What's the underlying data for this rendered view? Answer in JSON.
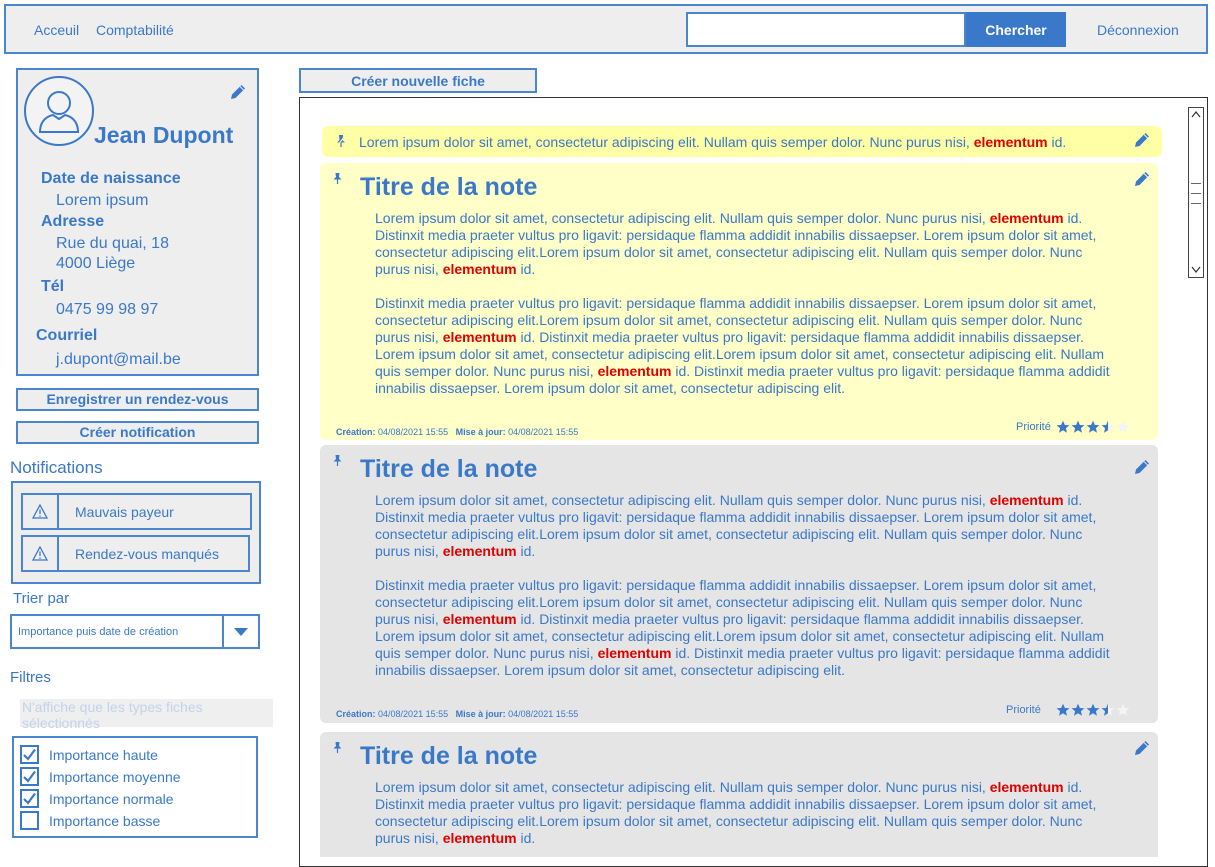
{
  "header": {
    "nav_home": "Acceuil",
    "nav_accounting": "Comptabilité",
    "search_value": "",
    "search_button": "Chercher",
    "logout": "Déconnexion"
  },
  "profile": {
    "name": "Jean Dupont",
    "birth_label": "Date de naissance",
    "birth_value": "Lorem ipsum",
    "address_label": "Adresse",
    "address_line1": "Rue du quai, 18",
    "address_line2": "4000 Liège",
    "phone_label": "Tél",
    "phone_value": "0475 99 98 97",
    "email_label": "Courriel",
    "email_value": "j.dupont@mail.be"
  },
  "actions": {
    "appointment": "Enregistrer un rendez-vous",
    "notification": "Créer notification",
    "create_sheet": "Créer nouvelle fiche"
  },
  "notifications": {
    "title": "Notifications",
    "items": [
      {
        "label": "Mauvais payeur"
      },
      {
        "label": "Rendez-vous manqués"
      }
    ]
  },
  "sort": {
    "title": "Trier par",
    "value": "Importance puis date de création"
  },
  "filters": {
    "title": "Filtres",
    "hint": "N'affiche que les types fiches sélectionnés",
    "items": [
      {
        "label": "Importance haute",
        "checked": true
      },
      {
        "label": "Importance moyenne",
        "checked": true
      },
      {
        "label": "Importance normale",
        "checked": true
      },
      {
        "label": "Importance basse",
        "checked": false
      }
    ]
  },
  "banner": {
    "text_before": "Lorem ipsum dolor sit amet, consectetur adipiscing elit. Nullam quis semper dolor. Nunc purus nisi, ",
    "highlight": "elementum",
    "text_after": " id."
  },
  "text": {
    "p1a": "Lorem ipsum dolor sit amet, consectetur adipiscing elit. Nullam quis semper dolor. Nunc purus nisi, ",
    "hl": "elementum",
    "p1b": " id. Distinxit  media praeter vultus pro ligavit: persidaque flamma addidit innabilis dissaepser. Lorem ipsum dolor sit amet, consectetur adipiscing elit.Lorem ipsum dolor sit amet, consectetur adipiscing elit. Nullam quis semper dolor. Nunc purus nisi, ",
    "p1c": " id.",
    "p2a": "Distinxit  media praeter vultus pro ligavit: persidaque flamma addidit innabilis dissaepser. Lorem ipsum dolor sit amet, consectetur adipiscing elit.Lorem ipsum dolor sit amet, consectetur adipiscing elit. Nullam quis semper dolor. Nunc purus nisi, ",
    "p2b": " id. Distinxit  media praeter vultus pro ligavit: persidaque flamma addidit innabilis dissaepser. Lorem ipsum dolor sit amet, consectetur adipiscing elit.Lorem ipsum dolor sit amet, consectetur adipiscing elit. Nullam quis semper dolor. Nunc purus nisi, ",
    "p2c": " id. Distinxit  media praeter vultus pro ligavit: persidaque flamma addidit innabilis dissaepser. Lorem ipsum dolor sit amet, consectetur adipiscing elit."
  },
  "notes": [
    {
      "title": "Titre de la note",
      "created_label": "Création:",
      "created": "04/08/2021 15:55",
      "updated_label": "Mise à jour:",
      "updated": "04/08/2021 15:55",
      "priority_label": "Priorité",
      "priority": 3.5,
      "priority_max": 5
    },
    {
      "title": "Titre de la note",
      "created_label": "Création:",
      "created": "04/08/2021 15:55",
      "updated_label": "Mise à jour:",
      "updated": "04/08/2021 15:55",
      "priority_label": "Priorité",
      "priority": 3.5,
      "priority_max": 5
    },
    {
      "title": "Titre de la note"
    }
  ],
  "colors": {
    "accent": "#3a78c9",
    "highlight": "#e00000",
    "note_yellow": "#ffffc8",
    "note_gray": "#e5e5e5",
    "panel": "#eeeeee"
  }
}
